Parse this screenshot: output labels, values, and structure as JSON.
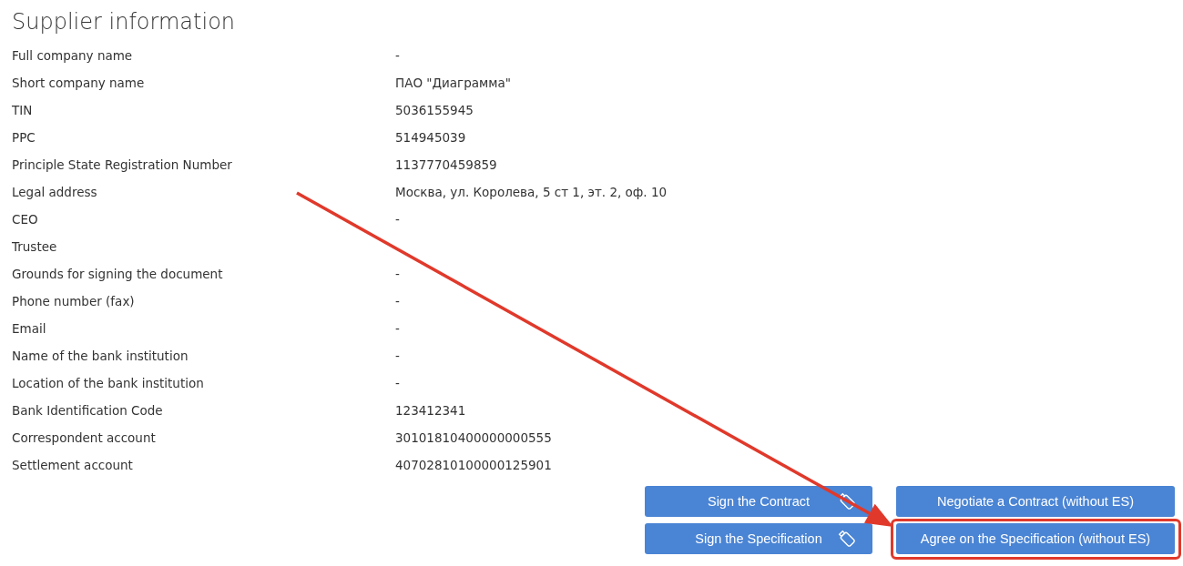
{
  "title": "Supplier information",
  "fields": [
    {
      "label": "Full company name",
      "value": "-"
    },
    {
      "label": "Short company name",
      "value": "ПАО \"Диаграмма\""
    },
    {
      "label": "TIN",
      "value": "5036155945"
    },
    {
      "label": "PPC",
      "value": "514945039"
    },
    {
      "label": "Principle State Registration Number",
      "value": "1137770459859"
    },
    {
      "label": "Legal address",
      "value": "Москва, ул. Королева, 5 ст 1, эт. 2, оф. 10"
    },
    {
      "label": "CEO",
      "value": "-"
    },
    {
      "label": "Trustee"
    },
    {
      "label": "Grounds for signing the document",
      "value": "-"
    },
    {
      "label": "Phone number (fax)",
      "value": "-"
    },
    {
      "label": "Email",
      "value": "-"
    },
    {
      "label": "Name of the bank institution",
      "value": "-"
    },
    {
      "label": "Location of the bank institution",
      "value": "-"
    },
    {
      "label": "Bank Identification Code",
      "value": "123412341"
    },
    {
      "label": "Correspondent account",
      "value": "30101810400000000555"
    },
    {
      "label": "Settlement account",
      "value": "40702810100000125901"
    }
  ],
  "buttons": [
    {
      "label": "Sign the Contract",
      "kind": "sign",
      "highlighted": false
    },
    {
      "label": "Negotiate a Contract (without ES)",
      "kind": "plain",
      "highlighted": false
    },
    {
      "label": "Sign the Specification",
      "kind": "sign",
      "highlighted": false
    },
    {
      "label": "Agree on the Specification (without ES)",
      "kind": "plain",
      "highlighted": true
    }
  ]
}
